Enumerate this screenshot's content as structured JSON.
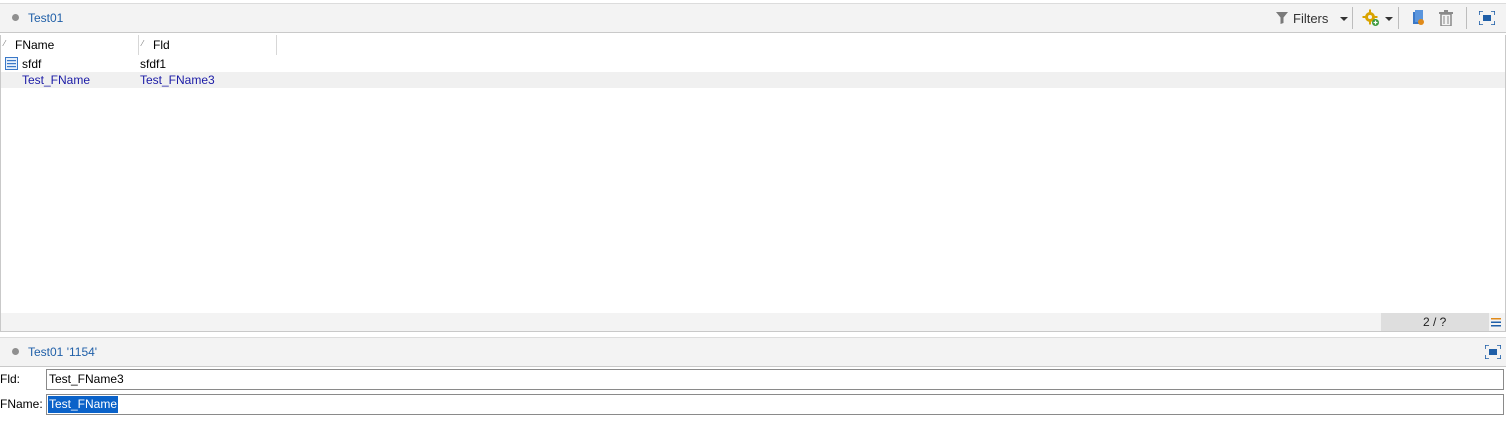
{
  "top_panel": {
    "title": "Test01",
    "toolbar": {
      "filters_label": "Filters",
      "icons": [
        "filter-icon",
        "gear-add-icon",
        "document-new-icon",
        "trash-icon",
        "maximize-icon"
      ]
    },
    "columns": [
      "FName",
      "Fld"
    ],
    "rows": [
      {
        "fname": "sfdf",
        "fld": "sfdf1",
        "icon": "table-row-icon",
        "selected": false
      },
      {
        "fname": "Test_FName",
        "fld": "Test_FName3",
        "selected": true
      }
    ],
    "status_count": "2 / ?"
  },
  "bottom_panel": {
    "title": "Test01 '1154'",
    "fields": [
      {
        "label": "Fld:",
        "value": "Test_FName3"
      },
      {
        "label": "FName:",
        "value": "Test_FName"
      }
    ]
  },
  "colors": {
    "accent_link": "#1f5fa8",
    "selected_text": "#1a1aa6",
    "selection_bg": "#0a62c9",
    "gear_yellow": "#d9a400"
  }
}
